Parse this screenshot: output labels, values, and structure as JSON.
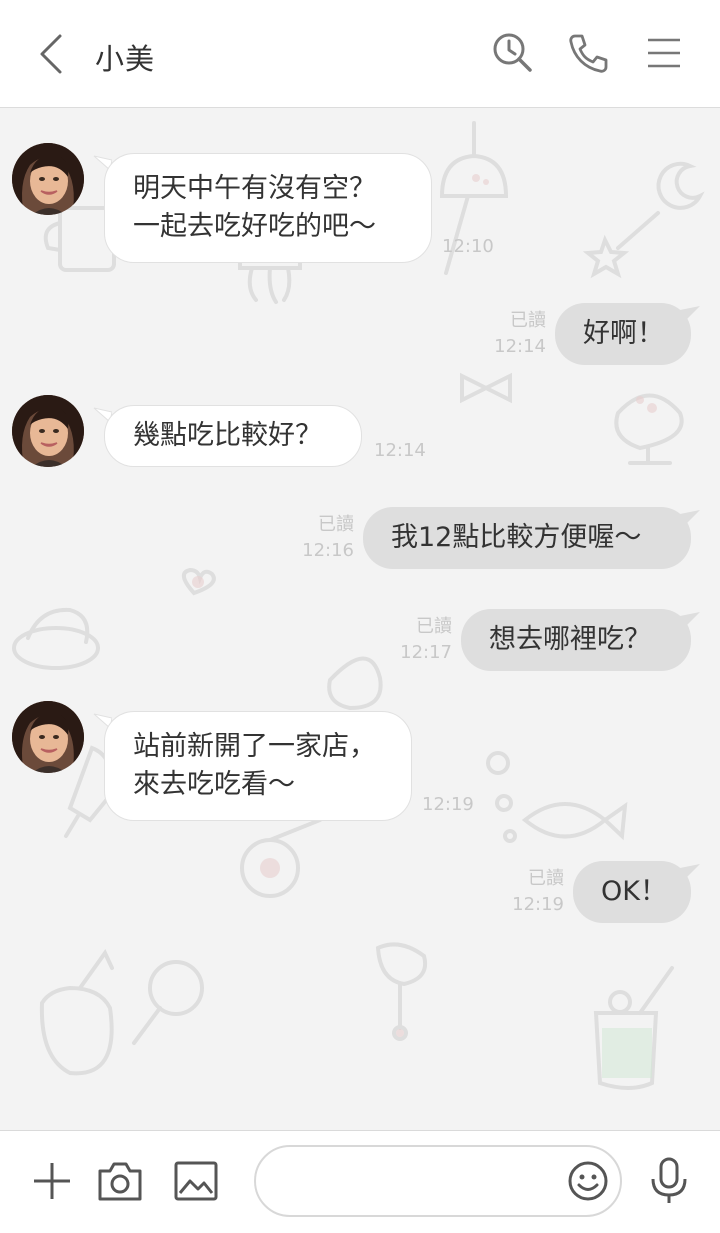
{
  "header": {
    "title": "小美"
  },
  "messages": [
    {
      "side": "in",
      "lines": [
        "明天中午有沒有空？",
        "一起去吃好吃的吧～"
      ],
      "time": "12:10"
    },
    {
      "side": "out",
      "lines": [
        "好啊！"
      ],
      "read": "已讀",
      "time": "12:14"
    },
    {
      "side": "in",
      "lines": [
        "幾點吃比較好？"
      ],
      "time": "12:14"
    },
    {
      "side": "out",
      "lines": [
        "我12點比較方便喔～"
      ],
      "read": "已讀",
      "time": "12:16"
    },
    {
      "side": "out",
      "lines": [
        "想去哪裡吃？"
      ],
      "read": "已讀",
      "time": "12:17"
    },
    {
      "side": "in",
      "lines": [
        "站前新開了一家店，",
        "來去吃吃看～"
      ],
      "time": "12:19"
    },
    {
      "side": "out",
      "lines": [
        "OK！"
      ],
      "read": "已讀",
      "time": "12:19"
    }
  ],
  "input": {
    "placeholder": "",
    "value": ""
  },
  "icons": {
    "back": "chevron-left-icon",
    "search": "search-history-icon",
    "call": "phone-icon",
    "menu": "hamburger-menu-icon",
    "add": "plus-icon",
    "camera": "camera-icon",
    "image": "image-icon",
    "emoji": "smiley-icon",
    "mic": "microphone-icon"
  },
  "colors": {
    "incoming_bubble": "#ffffff",
    "outgoing_bubble": "#dedede",
    "background": "#f3f3f3",
    "timestamp": "#c8c8c8"
  }
}
